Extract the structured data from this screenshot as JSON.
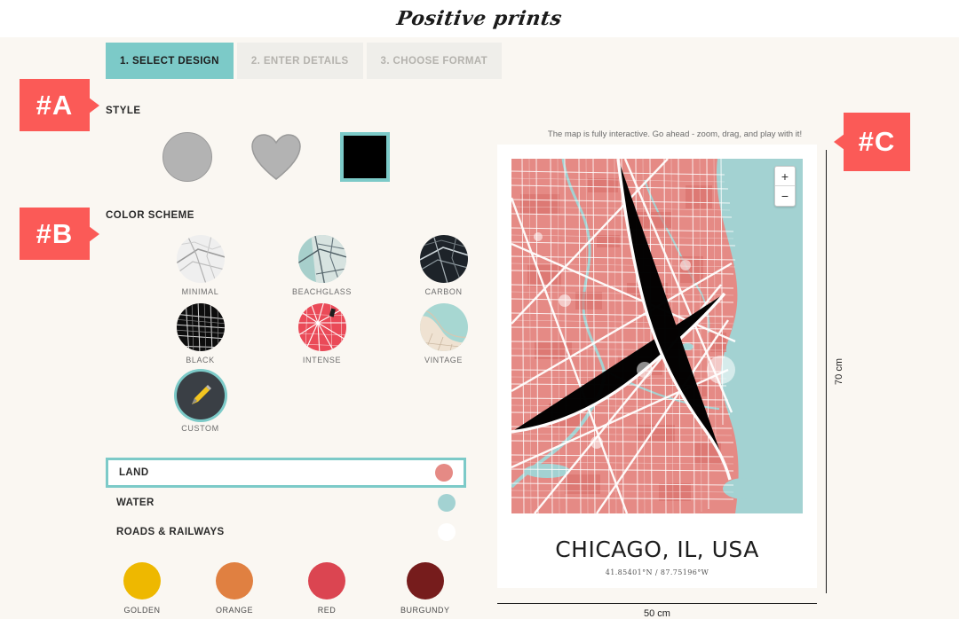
{
  "brand": {
    "logo": "Positive prints"
  },
  "tabs": [
    {
      "label": "1. SELECT DESIGN",
      "active": true
    },
    {
      "label": "2. ENTER DETAILS",
      "active": false
    },
    {
      "label": "3. CHOOSE FORMAT",
      "active": false
    }
  ],
  "style": {
    "heading": "STYLE",
    "options": [
      {
        "name": "circle",
        "selected": false
      },
      {
        "name": "heart",
        "selected": false
      },
      {
        "name": "square",
        "selected": true
      }
    ]
  },
  "color_scheme": {
    "heading": "COLOR SCHEME",
    "options": [
      {
        "label": "MINIMAL",
        "selected": false
      },
      {
        "label": "BEACHGLASS",
        "selected": false
      },
      {
        "label": "CARBON",
        "selected": false
      },
      {
        "label": "BLACK",
        "selected": false
      },
      {
        "label": "INTENSE",
        "selected": false
      },
      {
        "label": "VINTAGE",
        "selected": false
      },
      {
        "label": "CUSTOM",
        "selected": true
      }
    ]
  },
  "layers": [
    {
      "label": "LAND",
      "color": "#e58a85",
      "selected": true
    },
    {
      "label": "WATER",
      "color": "#a3d2d2",
      "selected": false
    },
    {
      "label": "ROADS & RAILWAYS",
      "color": "#ffffff",
      "selected": false
    }
  ],
  "palette": [
    {
      "label": "GOLDEN",
      "color": "#eeb800"
    },
    {
      "label": "ORANGE",
      "color": "#e08041"
    },
    {
      "label": "RED",
      "color": "#db4551"
    },
    {
      "label": "BURGUNDY",
      "color": "#761c1c"
    }
  ],
  "preview": {
    "hint": "The map is fully interactive. Go ahead - zoom, drag, and play with it!",
    "zoom_in": "+",
    "zoom_out": "−",
    "poster_title": "CHICAGO, IL, USA",
    "poster_coords": "41.85401°N / 87.75196°W",
    "height_label": "70 cm",
    "width_label": "50 cm"
  },
  "annotations": [
    {
      "label": "#A"
    },
    {
      "label": "#B"
    },
    {
      "label": "#C"
    }
  ],
  "colors": {
    "accent_teal": "#7ccac8",
    "annotation_red": "#fb5a57",
    "map_land": "#e58a85",
    "map_water": "#a3d2d2",
    "map_roads": "#ffffff",
    "page_bg": "#faf7f2"
  }
}
